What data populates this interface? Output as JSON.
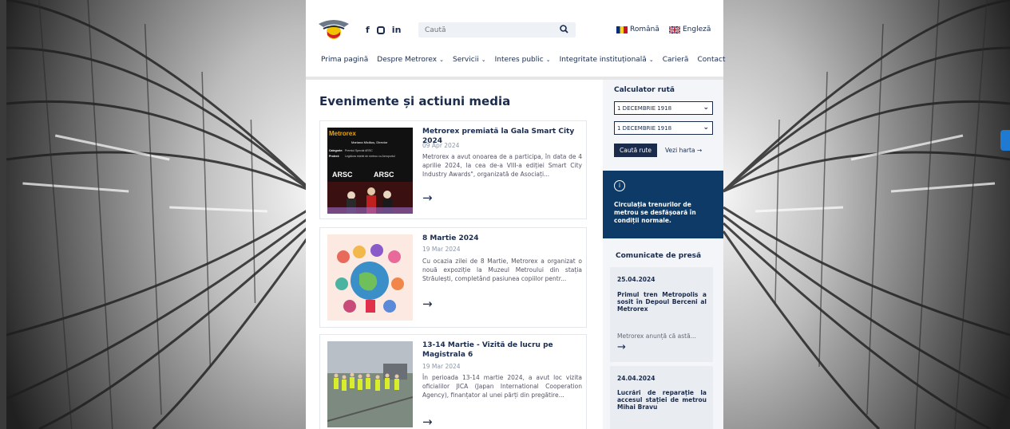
{
  "header": {
    "social": [
      "f",
      "in"
    ],
    "search_placeholder": "Caută",
    "lang_ro": "Română",
    "lang_en": "Engleză"
  },
  "nav": [
    {
      "label": "Prima pagină",
      "dropdown": false
    },
    {
      "label": "Despre Metrorex",
      "dropdown": true
    },
    {
      "label": "Servicii",
      "dropdown": true
    },
    {
      "label": "Interes public",
      "dropdown": true
    },
    {
      "label": "Integritate instituțională",
      "dropdown": true
    },
    {
      "label": "Carieră",
      "dropdown": false
    },
    {
      "label": "Contact",
      "dropdown": false
    }
  ],
  "main": {
    "title": "Evenimente și actiuni media",
    "cards": [
      {
        "title": "Metrorex premiată la Gala Smart City 2024",
        "date": "09 Apr 2024",
        "desc": "Metrorex a avut onoarea de a participa, în data de 4 aprilie 2024, la cea de-a VIII-a ediției Smart City Industry Awards\", organizată de Asociați...",
        "arrow": "→"
      },
      {
        "title": "8 Martie 2024",
        "date": "19 Mar 2024",
        "desc": "Cu ocazia zilei de 8 Martie, Metrorex a organizat o nouă expoziție la Muzeul Metroului din stația Străulești, completând pasiunea copiilor pentr...",
        "arrow": "→"
      },
      {
        "title": "13-14 Martie - Vizită de lucru pe Magistrala 6",
        "date": "19 Mar 2024",
        "desc": " În perioada 13-14 martie 2024, a avut loc vizita oficialilor JICA (Japan International Cooperation Agency), finanțator al unei părți din pregătire...",
        "arrow": "→"
      }
    ]
  },
  "sidebar": {
    "calc_title": "Calculator rută",
    "from": "1 DECEMBRIE 1918",
    "to": "1 DECEMBRIE 1918",
    "btn_routes": "Caută rute",
    "btn_map": "Vezi harta →",
    "info_icon": "i",
    "info_text": "Circulația trenurilor de metrou se desfășoară în condiții normale.",
    "press_title": "Comunicate de presă",
    "press": [
      {
        "date": "25.04.2024",
        "title": "Primul tren Metropolis a sosit în Depoul Berceni al Metrorex",
        "snippet": "Metrorex anunță că astă...",
        "arrow": "→"
      },
      {
        "date": "24.04.2024",
        "title": "Lucrări de reparație la accesul stației de metrou Mihai Bravu",
        "snippet": "",
        "arrow": ""
      }
    ]
  },
  "thumb_texts": {
    "metrorex": "Metrorex",
    "name": "Mariana Miclăuș, Director",
    "category_label": "Categorie:",
    "category": "Premiul Special ARSC",
    "project_label": "Proiect:",
    "project": "Legătura rețelei de metrou cu Aeroportul",
    "arsc": "ARSC"
  },
  "colors": {
    "navy": "#1a2b4c",
    "info_bg": "#0d3a66",
    "side_bg": "#f3f5f8"
  }
}
